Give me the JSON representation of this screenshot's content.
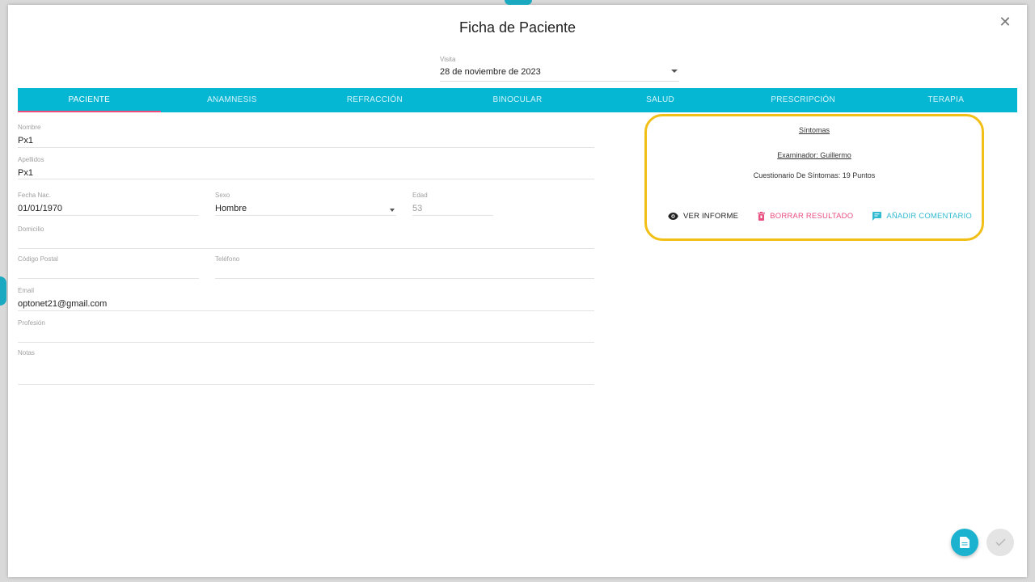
{
  "dialog": {
    "title": "Ficha de Paciente"
  },
  "visita": {
    "label": "Visita",
    "value": "28 de noviembre de 2023"
  },
  "tabs": [
    {
      "label": "PACIENTE",
      "active": true
    },
    {
      "label": "ANAMNESIS",
      "active": false
    },
    {
      "label": "REFRACCIÓN",
      "active": false
    },
    {
      "label": "BINOCULAR",
      "active": false
    },
    {
      "label": "SALUD",
      "active": false
    },
    {
      "label": "PRESCRIPCIÓN",
      "active": false
    },
    {
      "label": "TERAPIA",
      "active": false
    }
  ],
  "form": {
    "nombre": {
      "label": "Nombre",
      "value": "Px1"
    },
    "apellidos": {
      "label": "Apellidos",
      "value": "Px1"
    },
    "fecha_nac": {
      "label": "Fecha Nac.",
      "value": "01/01/1970"
    },
    "sexo": {
      "label": "Sexo",
      "value": "Hombre"
    },
    "edad": {
      "label": "Edad",
      "value": "53"
    },
    "domicilio": {
      "label": "Domicilio",
      "value": ""
    },
    "codigo_postal": {
      "label": "Código Postal",
      "value": ""
    },
    "telefono": {
      "label": "Teléfono",
      "value": ""
    },
    "email": {
      "label": "Email",
      "value": "optonet21@gmail.com"
    },
    "profesion": {
      "label": "Profesión",
      "value": ""
    },
    "notas": {
      "label": "Notas",
      "value": ""
    }
  },
  "result_card": {
    "title": "Síntomas",
    "examiner": "Examinador: Guillermo",
    "summary": "Cuestionario De Síntomas: 19 Puntos",
    "actions": {
      "view": "VER INFORME",
      "delete": "BORRAR RESULTADO",
      "comment": "AÑADIR COMENTARIO"
    }
  },
  "colors": {
    "accent": "#06b7d4",
    "tab_indicator": "#f04a7a",
    "highlight_border": "#f2bf17",
    "delete": "#e94f80"
  }
}
